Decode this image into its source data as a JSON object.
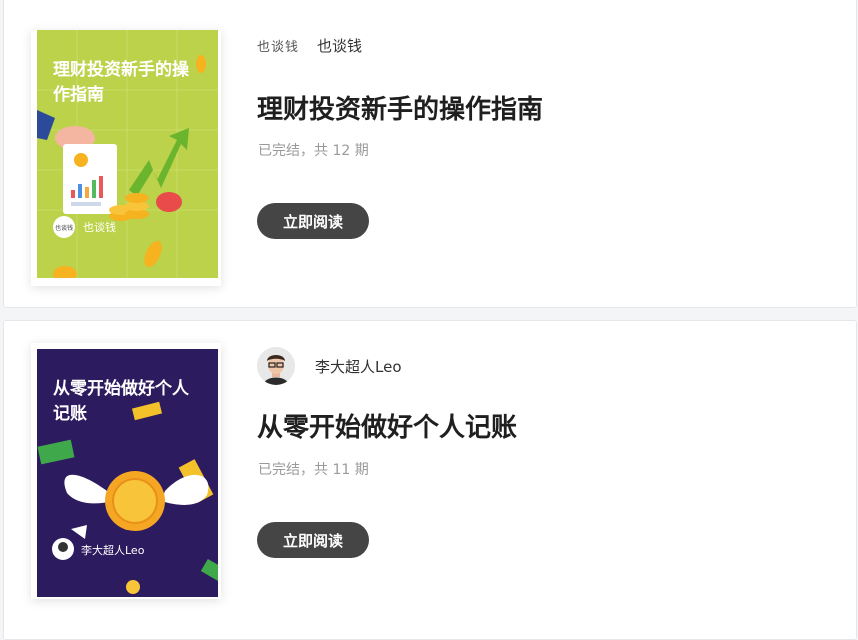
{
  "books": [
    {
      "cover_title": "理财投资新手的操作指南",
      "cover_brand": "也谈钱",
      "cover_badge": "也谈钱",
      "author_logo": "也谈钱",
      "author_name": "也谈钱",
      "title": "理财投资新手的操作指南",
      "status": "已完结，共 12 期",
      "button_label": "立即阅读",
      "cover_color": "#bcd24a"
    },
    {
      "cover_title": "从零开始做好个人记账",
      "cover_brand": "李大超人Leo",
      "author_name": "李大超人Leo",
      "title": "从零开始做好个人记账",
      "status": "已完结，共 11 期",
      "button_label": "立即阅读",
      "cover_color": "#2c1b5e"
    }
  ]
}
